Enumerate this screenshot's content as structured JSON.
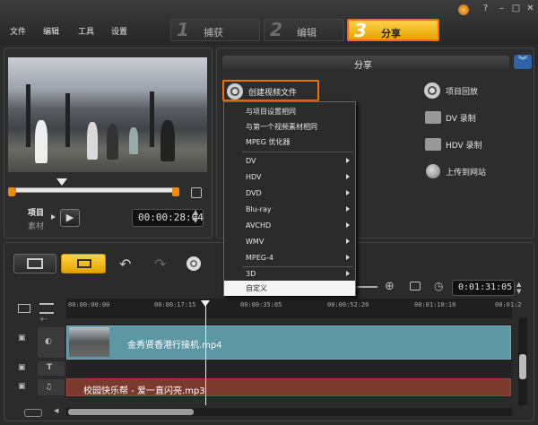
{
  "menu": {
    "file": "文件",
    "edit": "编辑",
    "tools": "工具",
    "settings": "设置"
  },
  "steps": [
    {
      "num": "1",
      "label": "捕获"
    },
    {
      "num": "2",
      "label": "编辑"
    },
    {
      "num": "3",
      "label": "分享"
    }
  ],
  "preview": {
    "mode_project": "项目",
    "mode_clip": "素材",
    "timecode": "00:00:28:04"
  },
  "share": {
    "title": "分享",
    "create_video": "创建视频文件",
    "options": {
      "project_playback": "项目回放",
      "dv_record": "DV 录制",
      "hdv_record": "HDV 录制",
      "upload_web": "上传到网站"
    }
  },
  "dropdown": {
    "same_as_project": "与项目设置相同",
    "same_as_first_clip": "与第一个视频素材相同",
    "mpeg_optimizer": "MPEG 优化器",
    "dv": "DV",
    "hdv": "HDV",
    "dvd": "DVD",
    "bluray": "Blu-ray",
    "avchd": "AVCHD",
    "wmv": "WMV",
    "mpeg4": "MPEG-4",
    "threed": "3D",
    "custom": "自定义"
  },
  "timeline": {
    "timecode": "0:01:31:05",
    "ruler": [
      "00:00:00:00",
      "00:00:17:15",
      "00:00:35:05",
      "00:00:52:20",
      "00:01:10:10",
      "00:01:2"
    ],
    "video_clip": "金秀贤香港行接机.mp4",
    "audio_clip": "校园快乐帮 - 爱一直闪亮.mp3",
    "zoom_label": "+-"
  },
  "colors": {
    "accent_orange": "#f07000",
    "share_tab": "#ffc21a",
    "video_clip": "#5e97a4",
    "audio_clip": "#7a3a2e"
  }
}
